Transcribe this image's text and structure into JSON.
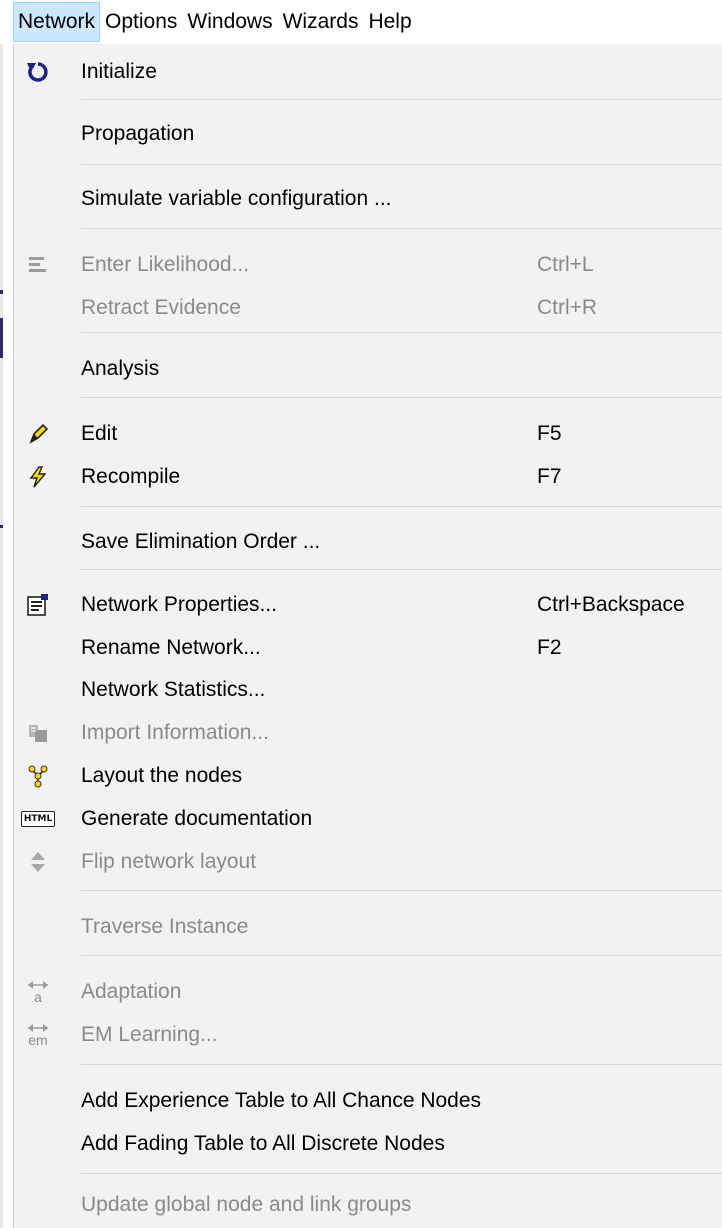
{
  "menubar": {
    "items": [
      {
        "label": "Network"
      },
      {
        "label": "Options"
      },
      {
        "label": "Windows"
      },
      {
        "label": "Wizards"
      },
      {
        "label": "Help"
      }
    ]
  },
  "menu": {
    "initialize": "Initialize",
    "propagation": "Propagation",
    "simulate": "Simulate variable configuration ...",
    "enter_likelihood": "Enter Likelihood...",
    "enter_likelihood_shortcut": "Ctrl+L",
    "retract_evidence": "Retract Evidence",
    "retract_evidence_shortcut": "Ctrl+R",
    "analysis": "Analysis",
    "edit": "Edit",
    "edit_shortcut": "F5",
    "recompile": "Recompile",
    "recompile_shortcut": "F7",
    "save_elimination": "Save Elimination Order ...",
    "network_properties": "Network Properties...",
    "network_properties_shortcut": "Ctrl+Backspace",
    "rename_network": "Rename Network...",
    "rename_network_shortcut": "F2",
    "network_statistics": "Network Statistics...",
    "import_information": "Import Information...",
    "layout_nodes": "Layout the nodes",
    "generate_documentation": "Generate documentation",
    "flip_layout": "Flip network layout",
    "traverse_instance": "Traverse Instance",
    "adaptation": "Adaptation",
    "em_learning": "EM Learning...",
    "add_experience": "Add Experience Table to All Chance Nodes",
    "add_fading": "Add Fading Table to All Discrete Nodes",
    "update_groups": "Update global node and link groups"
  },
  "icons": {
    "html_text": "HTML",
    "adaptation_text": "a",
    "em_text": "em"
  },
  "colors": {
    "menu_bg": "#f2f2f2",
    "highlight": "#cce8ff",
    "disabled_text": "#8a8a8a",
    "initialize_icon": "#1a237e"
  }
}
